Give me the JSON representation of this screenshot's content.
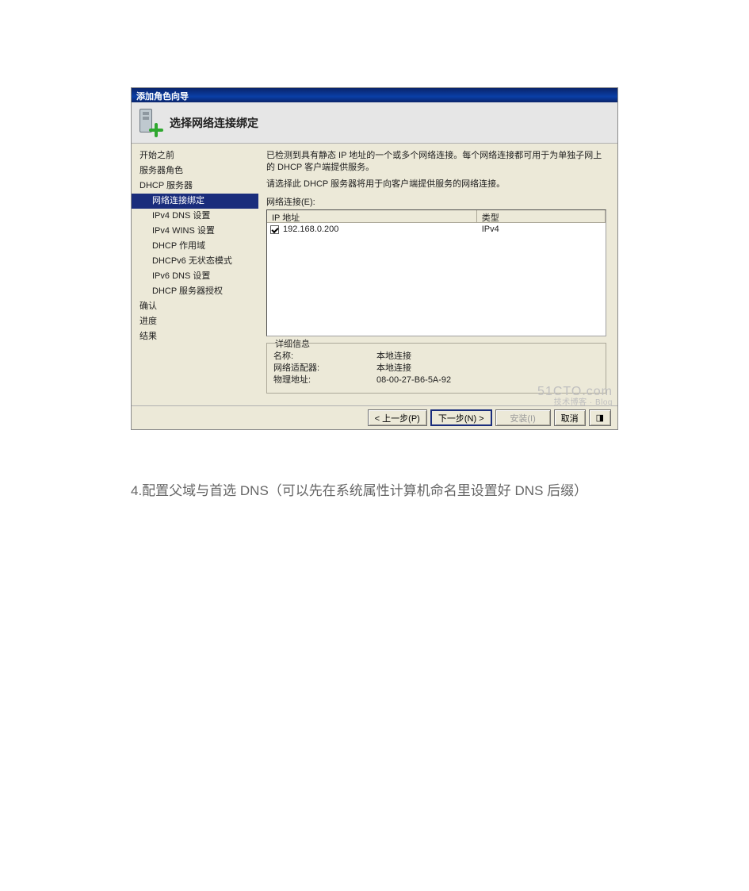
{
  "window": {
    "title": "添加角色向导"
  },
  "header": {
    "title": "选择网络连接绑定"
  },
  "sidebar": {
    "items": [
      "开始之前",
      "服务器角色",
      "DHCP 服务器",
      "网络连接绑定",
      "IPv4 DNS 设置",
      "IPv4 WINS 设置",
      "DHCP 作用域",
      "DHCPv6 无状态模式",
      "IPv6 DNS 设置",
      "DHCP 服务器授权",
      "确认",
      "进度",
      "结果"
    ]
  },
  "content": {
    "desc1": "已检测到具有静态 IP 地址的一个或多个网络连接。每个网络连接都可用于为单独子网上的 DHCP 客户端提供服务。",
    "desc2": "请选择此 DHCP 服务器将用于向客户端提供服务的网络连接。",
    "list_label": "网络连接(E):",
    "columns": {
      "ip": "IP 地址",
      "type": "类型"
    },
    "rows": [
      {
        "checked": true,
        "ip": "192.168.0.200",
        "type": "IPv4"
      }
    ],
    "details": {
      "legend": "详细信息",
      "name_label": "名称:",
      "name_value": "本地连接",
      "adapter_label": "网络适配器:",
      "adapter_value": "本地连接",
      "mac_label": "物理地址:",
      "mac_value": "08-00-27-B6-5A-92"
    }
  },
  "buttons": {
    "prev": "< 上一步(P)",
    "next": "下一步(N) >",
    "install": "安装(I)",
    "cancel_short": "取消"
  },
  "watermark": {
    "brand": "51CTO.com",
    "sub": "技术博客 · Blog"
  },
  "caption": "4.配置父域与首选 DNS（可以先在系统属性计算机命名里设置好 DNS 后缀）"
}
